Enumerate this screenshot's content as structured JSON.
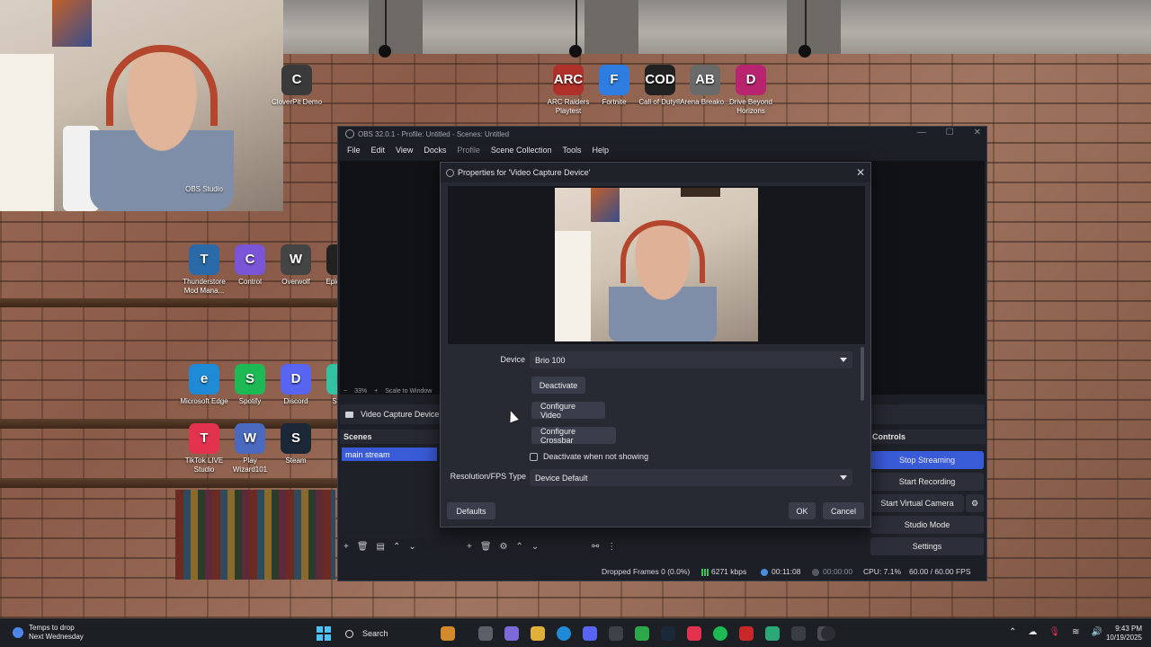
{
  "desktop": {
    "icons": [
      {
        "label": "CloverPit Demo",
        "icon": "cloverpit-icon",
        "color": "#3a3a3a",
        "glyph": "C"
      },
      {
        "label": "ARC Raiders Playtest",
        "icon": "arc-raiders-icon",
        "color": "#b0302a",
        "glyph": "ARC"
      },
      {
        "label": "Fortnite",
        "icon": "fortnite-icon",
        "color": "#2f7de0",
        "glyph": "F"
      },
      {
        "label": "Call of Duty®",
        "icon": "call-of-duty-icon",
        "color": "#222222",
        "glyph": "COD"
      },
      {
        "label": "Arena Breako...",
        "icon": "arena-breakout-icon",
        "color": "#6a6a6a",
        "glyph": "AB"
      },
      {
        "label": "Drive Beyond Horizons",
        "icon": "drive-beyond-horizons-icon",
        "color": "#b8246e",
        "glyph": "D"
      },
      {
        "label": "OBS Studio",
        "icon": "obs-icon",
        "color": "#2b2b2b",
        "glyph": ""
      },
      {
        "label": "Thunderstore Mod Mana...",
        "icon": "thunderstore-icon",
        "color": "#2a6aa8",
        "glyph": "T"
      },
      {
        "label": "Control",
        "icon": "control-icon",
        "color": "#7a55d8",
        "glyph": "C"
      },
      {
        "label": "Overwolf",
        "icon": "overwolf-icon",
        "color": "#444444",
        "glyph": "W"
      },
      {
        "label": "Epic Ga...",
        "icon": "epic-games-icon",
        "color": "#222222",
        "glyph": "E"
      },
      {
        "label": "Microsoft Edge",
        "icon": "edge-icon",
        "color": "#1f8bd6",
        "glyph": "e"
      },
      {
        "label": "Spotify",
        "icon": "spotify-icon",
        "color": "#1db954",
        "glyph": "S"
      },
      {
        "label": "Discord",
        "icon": "discord-icon",
        "color": "#5865f2",
        "glyph": "D"
      },
      {
        "label": "Stre...",
        "icon": "streamlabs-icon",
        "color": "#31c3a2",
        "glyph": "S"
      },
      {
        "label": "TikTok LIVE Studio",
        "icon": "tiktok-icon",
        "color": "#e3324e",
        "glyph": "T"
      },
      {
        "label": "Play Wizard101",
        "icon": "wizard101-icon",
        "color": "#4a6ac0",
        "glyph": "W"
      },
      {
        "label": "Steam",
        "icon": "steam-icon",
        "color": "#1b2838",
        "glyph": "S"
      }
    ]
  },
  "obs": {
    "title": "OBS 32.0.1 - Profile: Untitled - Scenes: Untitled",
    "menu": [
      "File",
      "Edit",
      "View",
      "Docks",
      "Profile",
      "Scene Collection",
      "Tools",
      "Help"
    ],
    "zoom": "33%",
    "scale_label": "Scale to Window",
    "source_name": "Video Capture Device",
    "scenes_header": "Scenes",
    "scenes": [
      "main stream"
    ],
    "controls_header": "Controls",
    "controls": {
      "stop_streaming": "Stop Streaming",
      "start_recording": "Start Recording",
      "start_virtual_camera": "Start Virtual Camera",
      "studio_mode": "Studio Mode",
      "settings": "Settings"
    },
    "status": {
      "dropped_frames": "Dropped Frames 0 (0.0%)",
      "bitrate": "6271 kbps",
      "stream_time": "00:11:08",
      "record_time": "00:00:00",
      "cpu": "CPU: 7.1%",
      "fps": "60.00 / 60.00 FPS"
    }
  },
  "dialog": {
    "title": "Properties for 'Video Capture Device'",
    "device_label": "Device",
    "device_value": "Brio 100",
    "deactivate_button": "Deactivate",
    "configure_video_button": "Configure Video",
    "configure_crossbar_button": "Configure Crossbar",
    "deactivate_checkbox": "Deactivate when not showing",
    "resolution_label": "Resolution/FPS Type",
    "resolution_value": "Device Default",
    "defaults_button": "Defaults",
    "ok_button": "OK",
    "cancel_button": "Cancel"
  },
  "taskbar": {
    "weather_title": "Temps to drop",
    "weather_sub": "Next Wednesday",
    "search_label": "Search",
    "time": "9:43 PM",
    "date": "10/19/2025"
  }
}
